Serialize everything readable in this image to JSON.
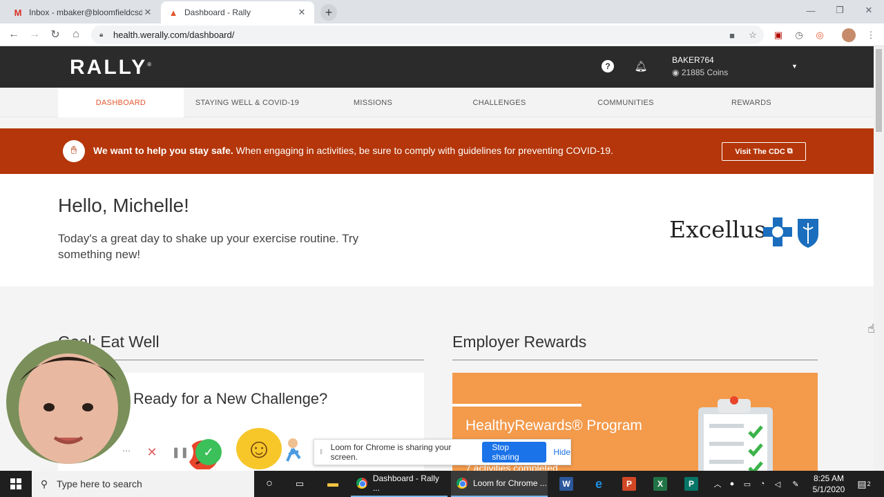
{
  "browser": {
    "tabs": [
      {
        "title": "Inbox - mbaker@bloomfieldcsd.o",
        "icon": "gmail-icon"
      },
      {
        "title": "Dashboard - Rally",
        "icon": "rally-icon"
      }
    ],
    "url": "health.werally.com/dashboard/"
  },
  "header": {
    "logo": "RALLY",
    "username": "BAKER764",
    "coins": "21885 Coins"
  },
  "nav": [
    "DASHBOARD",
    "STAYING WELL & COVID-19",
    "MISSIONS",
    "CHALLENGES",
    "COMMUNITIES",
    "REWARDS"
  ],
  "banner": {
    "bold": "We want to help you stay safe.",
    "text": " When engaging in activities, be sure to comply with guidelines for preventing COVID-19.",
    "button": "Visit The CDC"
  },
  "greeting": {
    "title": "Hello, Michelle!",
    "message": "Today's a great day to shake up your exercise routine. Try something new!",
    "sponsor": "Excellus"
  },
  "sections": {
    "goal_title": "Goal: Eat Well",
    "goal_card": "Ready for a New Challenge?",
    "rewards_title": "Employer Rewards",
    "rewards_card": "HealthyRewards® Program",
    "rewards_sub": "7 activities completed"
  },
  "loom": {
    "message": "Loom for Chrome is sharing your screen.",
    "stop": "Stop sharing",
    "hide": "Hide"
  },
  "taskbar": {
    "search_placeholder": "Type here to search",
    "apps": [
      "Dashboard - Rally ...",
      "Loom for Chrome ..."
    ],
    "time": "8:25 AM",
    "date": "5/1/2020",
    "notifications": "2"
  },
  "colors": {
    "accent": "#e1542a",
    "banner": "#b4360a",
    "rewards_card": "#f39a4b",
    "header": "#2b2b2b"
  }
}
